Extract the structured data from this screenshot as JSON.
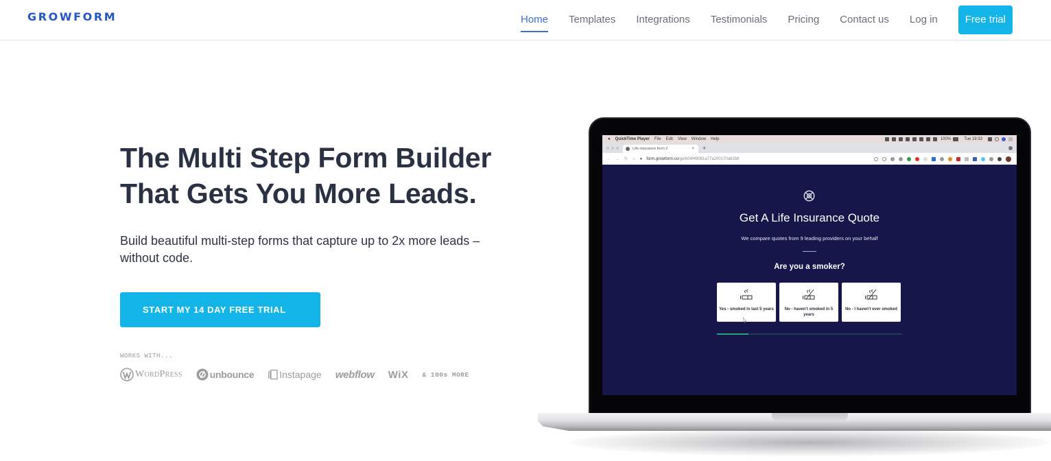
{
  "brand": {
    "logo": "GROWFORM",
    "accent": "#2456c4",
    "cta_color": "#13b5e9"
  },
  "nav": {
    "items": [
      {
        "label": "Home",
        "active": true
      },
      {
        "label": "Templates",
        "active": false
      },
      {
        "label": "Integrations",
        "active": false
      },
      {
        "label": "Testimonials",
        "active": false
      },
      {
        "label": "Pricing",
        "active": false
      },
      {
        "label": "Contact us",
        "active": false
      },
      {
        "label": "Log in",
        "active": false
      }
    ],
    "cta": "Free trial"
  },
  "hero": {
    "title_line1": "The Multi Step Form Builder",
    "title_line2": "That Gets You More Leads.",
    "subtitle": "Build beautiful multi-step forms that capture up to 2x more leads – without code.",
    "cta": "START MY 14 DAY FREE TRIAL",
    "works_with_label": "WORKS WITH...",
    "integrations": [
      "WordPress",
      "unbounce",
      "Instapage",
      "webflow",
      "WiX"
    ],
    "more": "& 100s MORE"
  },
  "laptop": {
    "menubar": {
      "app": "QuickTime Player",
      "menus": [
        "File",
        "Edit",
        "View",
        "Window",
        "Help"
      ],
      "battery": "100%",
      "clock": "Tue 19:33"
    },
    "browser": {
      "tab_title": "Life insurance form 2",
      "url_host": "form.growform.co",
      "url_path": "/go/604f49061a77a200170a82b8"
    },
    "form": {
      "title": "Get A Life Insurance Quote",
      "description": "We compare quotes from 9 leading providers on your behalf",
      "question": "Are you a smoker?",
      "options": [
        "Yes - smoked in last 5 years",
        "No - haven't smoked in 5 years",
        "No - I haven't ever smoked"
      ],
      "progress": 0.17,
      "progress_color": "#25a17a",
      "background": "#16164a"
    }
  }
}
